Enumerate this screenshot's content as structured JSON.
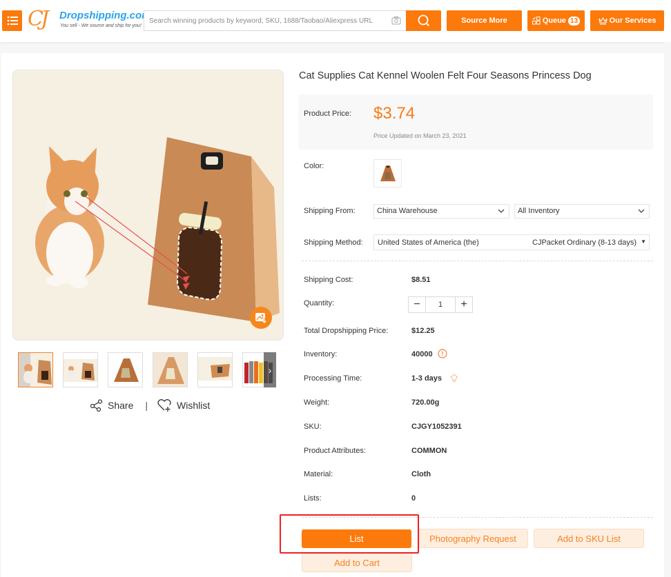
{
  "header": {
    "logo": {
      "mark": "CJ",
      "brand": "Dropshipping.com",
      "tagline": "You sell - We source and ship for you!"
    },
    "search": {
      "placeholder": "Search winning products by keyword, SKU, 1688/Taobao/Aliexpress URL",
      "value": ""
    },
    "buttons": {
      "source_more": "Source More",
      "queue": "Queue",
      "queue_count": "13",
      "our_services": "Our Services"
    },
    "icons": [
      "menu-icon",
      "camera-icon",
      "search-icon",
      "queue-icon",
      "crown-icon"
    ]
  },
  "gallery": {
    "thumbnails": [
      {
        "name": "cat-and-kennel",
        "active": true
      },
      {
        "name": "cat-and-kennel-small",
        "active": false
      },
      {
        "name": "kennel-front",
        "active": false
      },
      {
        "name": "kennel-open",
        "active": false
      },
      {
        "name": "kennel-folded",
        "active": false
      },
      {
        "name": "color-options",
        "active": false
      }
    ],
    "share_label": "Share",
    "separator": "|",
    "wishlist_label": "Wishlist"
  },
  "product": {
    "title": "Cat Supplies Cat Kennel Woolen Felt Four Seasons Princess Dog",
    "price_label": "Product Price:",
    "price": "$3.74",
    "price_updated": "Price Updated on March 23, 2021",
    "color_label": "Color:",
    "shipping_from_label": "Shipping From:",
    "shipping_from_value": "China Warehouse",
    "inventory_filter_value": "All Inventory",
    "shipping_method_label": "Shipping Method:",
    "shipping_country": "United States of America (the)",
    "shipping_method": "CJPacket Ordinary (8-13 days)",
    "details": [
      {
        "label": "Shipping Cost:",
        "value": "$8.51"
      },
      {
        "label": "Quantity:",
        "value": "1"
      },
      {
        "label": "Total Dropshipping Price:",
        "value": "$12.25"
      },
      {
        "label": "Inventory:",
        "value": "40000"
      },
      {
        "label": "Processing Time:",
        "value": "1-3 days"
      },
      {
        "label": "Weight:",
        "value": "720.00g"
      },
      {
        "label": "SKU:",
        "value": "CJGY1052391"
      },
      {
        "label": "Product Attributes:",
        "value": "COMMON"
      },
      {
        "label": "Material:",
        "value": "Cloth"
      },
      {
        "label": "Lists:",
        "value": "0"
      }
    ]
  },
  "actions": {
    "list": "List",
    "photography_request": "Photography Request",
    "add_to_sku_list": "Add to SKU List",
    "add_to_cart": "Add to Cart"
  },
  "colors": {
    "accent": "#fb7a0b",
    "price": "#f77b1a",
    "highlight": "#ef2020",
    "light_button_bg": "#fdeee0"
  }
}
